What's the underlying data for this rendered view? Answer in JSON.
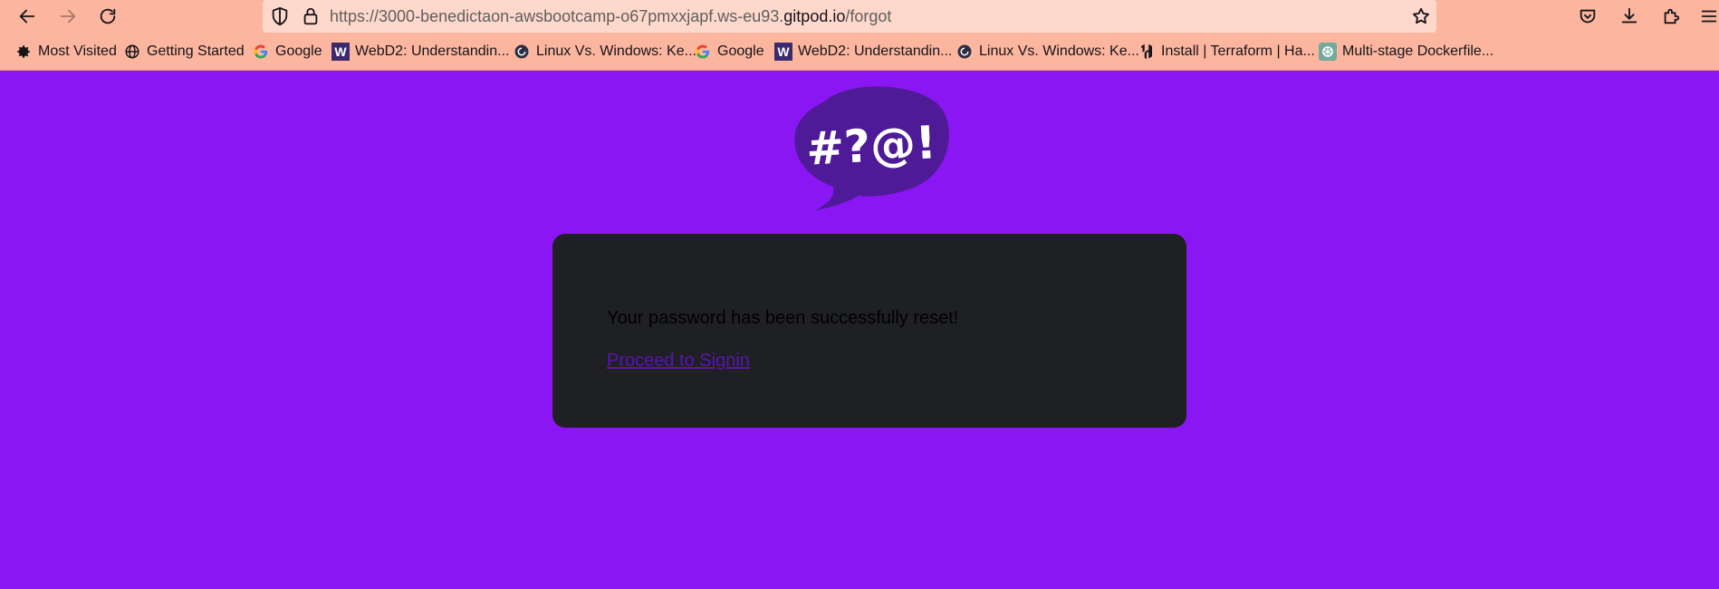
{
  "browser": {
    "url_prefix": "https://3000-benedictaon-awsbootcamp-o67pmxxjapf.ws-eu93.",
    "url_host": "gitpod.io",
    "url_path": "/forgot"
  },
  "bookmarks": [
    {
      "label": "Most Visited",
      "icon": "gear-icon"
    },
    {
      "label": "Getting Started",
      "icon": "globe-icon"
    },
    {
      "label": "Google",
      "icon": "google-icon"
    },
    {
      "label": "WebD2: Understandin...",
      "icon": "w-icon"
    },
    {
      "label": "Linux Vs. Windows: Ke...",
      "icon": "spiral-icon"
    },
    {
      "label": "Google",
      "icon": "google-icon"
    },
    {
      "label": "WebD2: Understandin...",
      "icon": "w-icon"
    },
    {
      "label": "Linux Vs. Windows: Ke...",
      "icon": "spiral-icon"
    },
    {
      "label": "Install | Terraform | Ha...",
      "icon": "hashicorp-icon"
    },
    {
      "label": "Multi-stage Dockerfile...",
      "icon": "openai-icon"
    }
  ],
  "logo": {
    "text": "#?@!",
    "bubble_color": "#4f1a97"
  },
  "card": {
    "message": "Your password has been successfully reset!",
    "link": "Proceed to Signin"
  },
  "colors": {
    "page_background": "#8a17f3",
    "chrome_background": "#fcb69f",
    "card_background": "#1f2023",
    "link_color": "#5a14b0"
  }
}
